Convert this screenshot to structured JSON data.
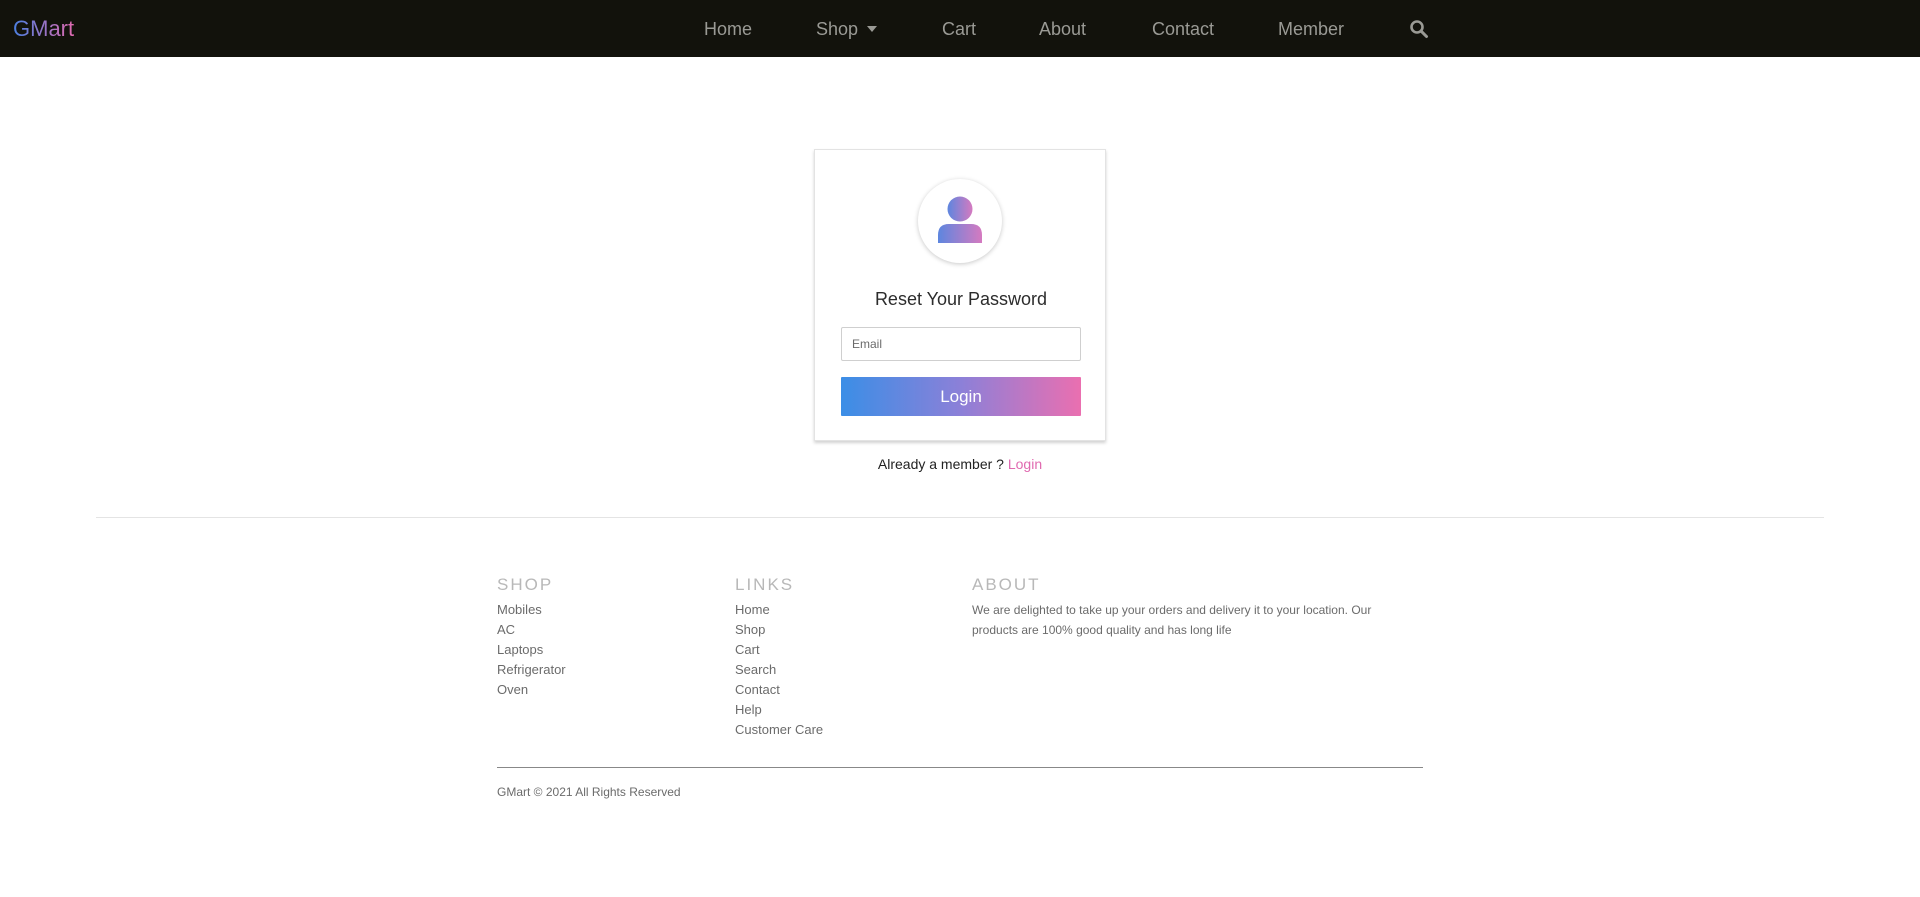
{
  "navbar": {
    "brand": "GMart",
    "links": {
      "home": "Home",
      "shop": "Shop",
      "cart": "Cart",
      "about": "About",
      "contact": "Contact",
      "member": "Member"
    },
    "search_icon": "search-icon"
  },
  "card": {
    "avatar_icon": "user-icon",
    "title": "Reset Your Password",
    "email_placeholder": "Email",
    "email_value": "",
    "button_label": "Login"
  },
  "below_card": {
    "prompt": "Already a member ? ",
    "link": "Login"
  },
  "footer": {
    "shop": {
      "heading": "SHOP",
      "items": [
        "Mobiles",
        "AC",
        "Laptops",
        "Refrigerator",
        "Oven"
      ]
    },
    "links": {
      "heading": "LINKS",
      "items": [
        "Home",
        "Shop",
        "Cart",
        "Search",
        "Contact",
        "Help",
        "Customer Care"
      ]
    },
    "about": {
      "heading": "ABOUT",
      "text": "We are delighted to take up your orders and delivery it to your location. Our products are 100% good quality and has long life"
    },
    "copyright": "GMart © 2021 All Rights Reserved"
  },
  "colors": {
    "navbar_bg": "#12120c",
    "accent_blue": "#3b8ee6",
    "accent_pink": "#ea6fb0"
  }
}
